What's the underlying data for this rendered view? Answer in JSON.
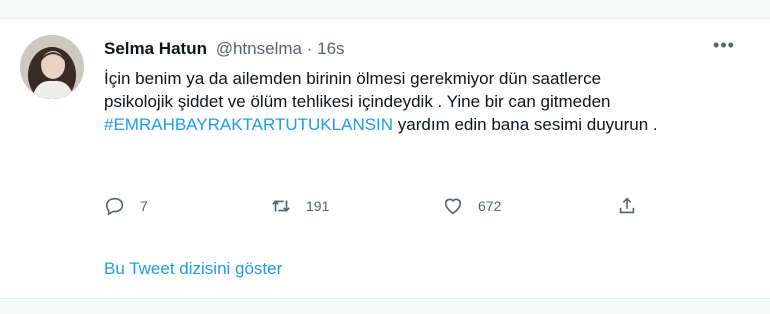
{
  "tweet": {
    "author_name": "Selma Hatun",
    "handle": "@htnselma",
    "separator": "·",
    "time": "16s",
    "text_before": "İçin benim ya da ailemden birinin ölmesi gerekmiyor dün saatlerce psikolojik şiddet ve ölüm tehlikesi içindeydik . Yine bir can gitmeden ",
    "hashtag": "#EMRAHBAYRAKTARTUTUKLANSIN",
    "text_after": " yardım edin bana sesimi duyurun .",
    "reply_count": "7",
    "retweet_count": "191",
    "like_count": "672",
    "more_icon": "more-icon",
    "show_thread": "Bu Tweet dizisini göster"
  },
  "colors": {
    "accent": "#1d9bf0",
    "text": "#0f1419",
    "muted": "#536471"
  }
}
